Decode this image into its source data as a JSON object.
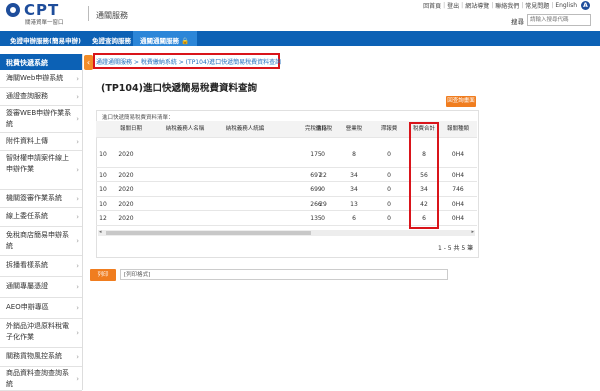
{
  "header": {
    "logo_text": "CPT",
    "logo_sub": "關港貿單一窗口",
    "site_name": "通關服務",
    "toplinks": [
      "回首頁",
      "登出",
      "網站導覽",
      "聯絡我們",
      "常見問題",
      "English"
    ],
    "accessibility_letter": "A",
    "search_label": "搜尋",
    "search_placeholder": "請輸入搜尋代碼"
  },
  "nav": {
    "items": [
      "免證申辦服務(簡易申辦)",
      "免證查詢服務",
      "通關通關服務"
    ],
    "active_index": 2
  },
  "sidebar": {
    "head": "稅費快遞系統",
    "items": [
      "海關Web申辦系統",
      "通證查詢服務",
      "簽審WEB申辦作業系統",
      "附件資料上傳",
      "智財權申請案件線上申辦作業",
      "機關簽審作業系統",
      "線上委任系統",
      "免稅商店簡易申辦系統",
      "拆播看樣系統",
      "通關專屬憑證",
      "AEO申辦專區",
      "外銷品沖退原料稅電子化作業",
      "關務貨物風控系統",
      "商品資料查詢查詢系統"
    ]
  },
  "breadcrumb": "通證通關服務 > 稅費繳納系統 > (TP104)進口快遞簡易稅費資料查詢",
  "page_title": "(TP104)進口快遞簡易稅費資料查詢",
  "back_button": "回查詢畫面",
  "panel_title": "進口快遞簡易稅費資料清單：",
  "table": {
    "headers": [
      "",
      "報關日期",
      "納稅義務人名稱",
      "納稅義務人統編",
      "完稅價格",
      "進口稅",
      "營業稅",
      "滯報費",
      "稅費合計",
      "報關種類"
    ],
    "rows": [
      [
        "10",
        "2020",
        "",
        "",
        "175",
        "0",
        "8",
        "0",
        "8",
        "0H4"
      ],
      [
        "10",
        "2020",
        "",
        "",
        "697",
        "22",
        "34",
        "0",
        "56",
        "0H4"
      ],
      [
        "10",
        "2020",
        "",
        "",
        "699",
        "0",
        "34",
        "0",
        "34",
        "746"
      ],
      [
        "10",
        "2020",
        "",
        "",
        "266",
        "29",
        "13",
        "0",
        "42",
        "0H4"
      ],
      [
        "12",
        "2020",
        "",
        "",
        "135",
        "0",
        "6",
        "0",
        "6",
        "0H4"
      ]
    ]
  },
  "pager": "1 - 5 共 5 筆",
  "print_button": "列印",
  "print_field_value": "[列印格式]",
  "colors": {
    "brand": "#0c61b5",
    "accent": "#f07d1f",
    "highlight": "#d9141a"
  }
}
